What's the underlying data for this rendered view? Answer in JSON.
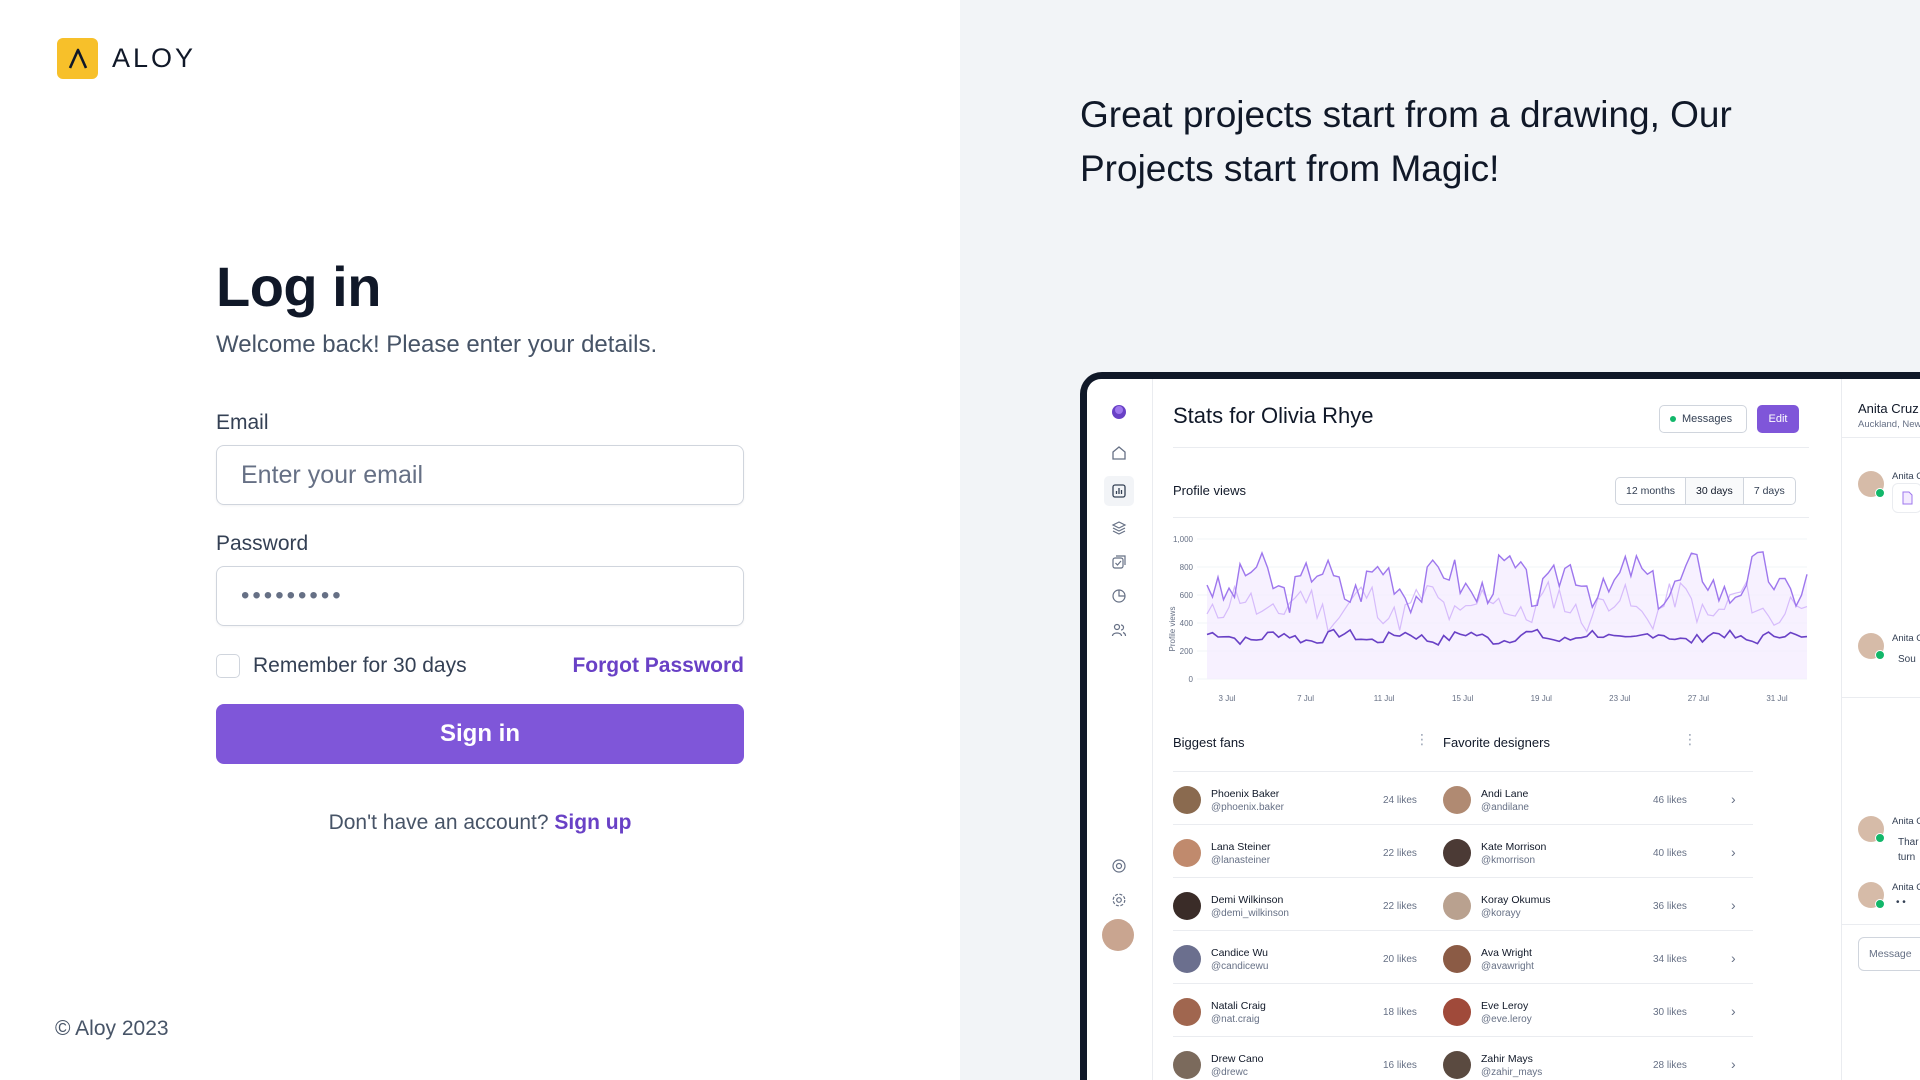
{
  "brand": {
    "name": "ALOY",
    "mark_color": "#f7c02a"
  },
  "login": {
    "title": "Log in",
    "subtitle": "Welcome back! Please enter your details.",
    "email_label": "Email",
    "email_placeholder": "Enter your email",
    "password_label": "Password",
    "password_value": "•••••••••",
    "remember_label": "Remember for 30 days",
    "remember_checked": false,
    "forgot_label": "Forgot Password",
    "submit_label": "Sign in",
    "no_account_text": "Don't have an account?",
    "signup_label": "Sign up"
  },
  "footer": {
    "copyright": "© Aloy 2023"
  },
  "promo": {
    "headline": "Great projects start from a drawing, Our Projects start from Magic!"
  },
  "preview": {
    "title": "Stats for Olivia Rhye",
    "messages_button": "Messages",
    "edit_button": "Edit",
    "profile_views_label": "Profile views",
    "ranges": [
      "12 months",
      "30 days",
      "7 days"
    ],
    "selected_range": "30 days",
    "chart_ylabel": "Profile views",
    "y_ticks": [
      "1,000",
      "800",
      "600",
      "400",
      "200",
      "0"
    ],
    "x_ticks": [
      "3 Jul",
      "7 Jul",
      "11 Jul",
      "15 Jul",
      "19 Jul",
      "23 Jul",
      "27 Jul",
      "31 Jul"
    ],
    "fans_title": "Biggest fans",
    "fans": [
      {
        "name": "Phoenix Baker",
        "handle": "@phoenix.baker",
        "likes": "24 likes",
        "color": "#8a6a4f"
      },
      {
        "name": "Lana Steiner",
        "handle": "@lanasteiner",
        "likes": "22 likes",
        "color": "#c08a6d"
      },
      {
        "name": "Demi Wilkinson",
        "handle": "@demi_wilkinson",
        "likes": "22 likes",
        "color": "#3a2c28"
      },
      {
        "name": "Candice Wu",
        "handle": "@candicewu",
        "likes": "20 likes",
        "color": "#6b6f8e"
      },
      {
        "name": "Natali Craig",
        "handle": "@nat.craig",
        "likes": "18 likes",
        "color": "#a0664f"
      },
      {
        "name": "Drew Cano",
        "handle": "@drewc",
        "likes": "16 likes",
        "color": "#7b6a5c"
      }
    ],
    "designers_title": "Favorite designers",
    "designers": [
      {
        "name": "Andi Lane",
        "handle": "@andilane",
        "likes": "46 likes",
        "color": "#b08a72"
      },
      {
        "name": "Kate Morrison",
        "handle": "@kmorrison",
        "likes": "40 likes",
        "color": "#4b3a35"
      },
      {
        "name": "Koray Okumus",
        "handle": "@korayy",
        "likes": "36 likes",
        "color": "#b9a18f"
      },
      {
        "name": "Ava Wright",
        "handle": "@avawright",
        "likes": "34 likes",
        "color": "#8b5b45"
      },
      {
        "name": "Eve Leroy",
        "handle": "@eve.leroy",
        "likes": "30 likes",
        "color": "#a04a3a"
      },
      {
        "name": "Zahir Mays",
        "handle": "@zahir_mays",
        "likes": "28 likes",
        "color": "#5a4a40"
      }
    ],
    "chat": {
      "name": "Anita Cruz",
      "location": "Auckland, New",
      "sender_short": "Anita C",
      "snippet_1": "Sou",
      "snippet_2": "Thar",
      "snippet_3": "turn",
      "typing": "• •",
      "message_placeholder": "Message"
    }
  },
  "colors": {
    "accent": "#7f56d9",
    "accent_text": "#6941c6",
    "right_bg": "#f2f4f7"
  }
}
